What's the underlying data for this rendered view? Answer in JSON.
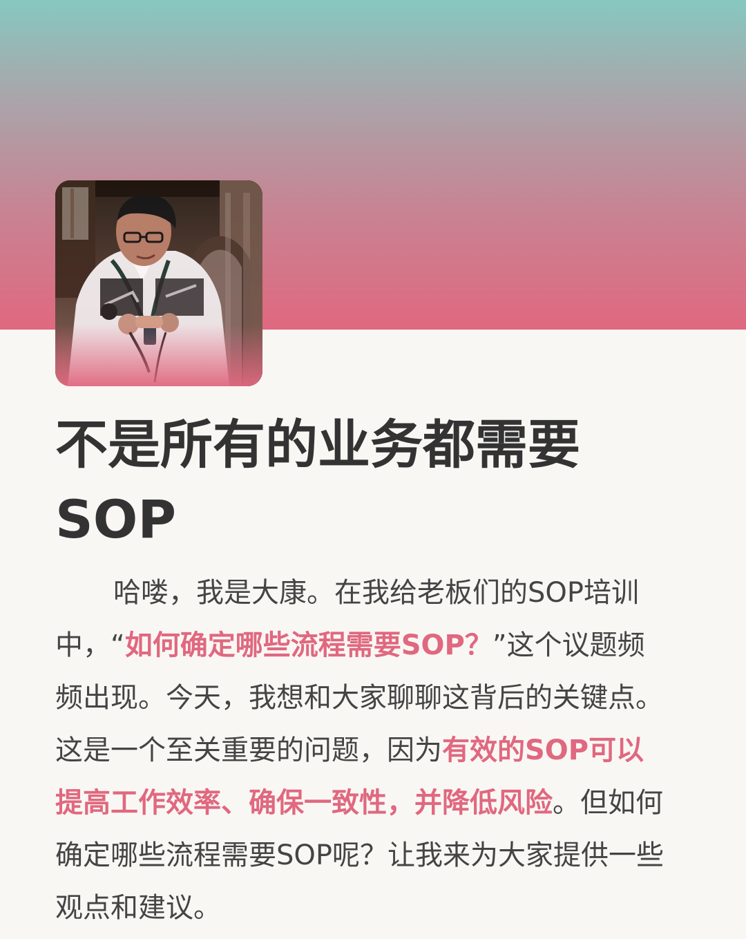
{
  "header": {
    "background_colors": [
      "#86c8c0",
      "#c68594",
      "#e0687f"
    ]
  },
  "avatar": {
    "icon": "person-photo"
  },
  "article": {
    "title": "不是所有的业务都需要SOP",
    "paragraph_part1": "哈喽，我是大康。在我给老板们的SOP培训中，“",
    "highlight1": "如何确定哪些流程需要SOP？",
    "paragraph_part2": "”这个议题频频出现。今天，我想和大家聊聊这背后的关键点。这是一个至关重要的问题，因为",
    "highlight2": "有效的SOP可以提高工作效率、确保一致性，并降低风险",
    "paragraph_part3": "。但如何确定哪些流程需要SOP呢？让我来为大家提供一些观点和建议。"
  },
  "colors": {
    "accent": "#e0687f",
    "text": "#444444",
    "title": "#333333",
    "page_background": "#f9f7f4"
  }
}
